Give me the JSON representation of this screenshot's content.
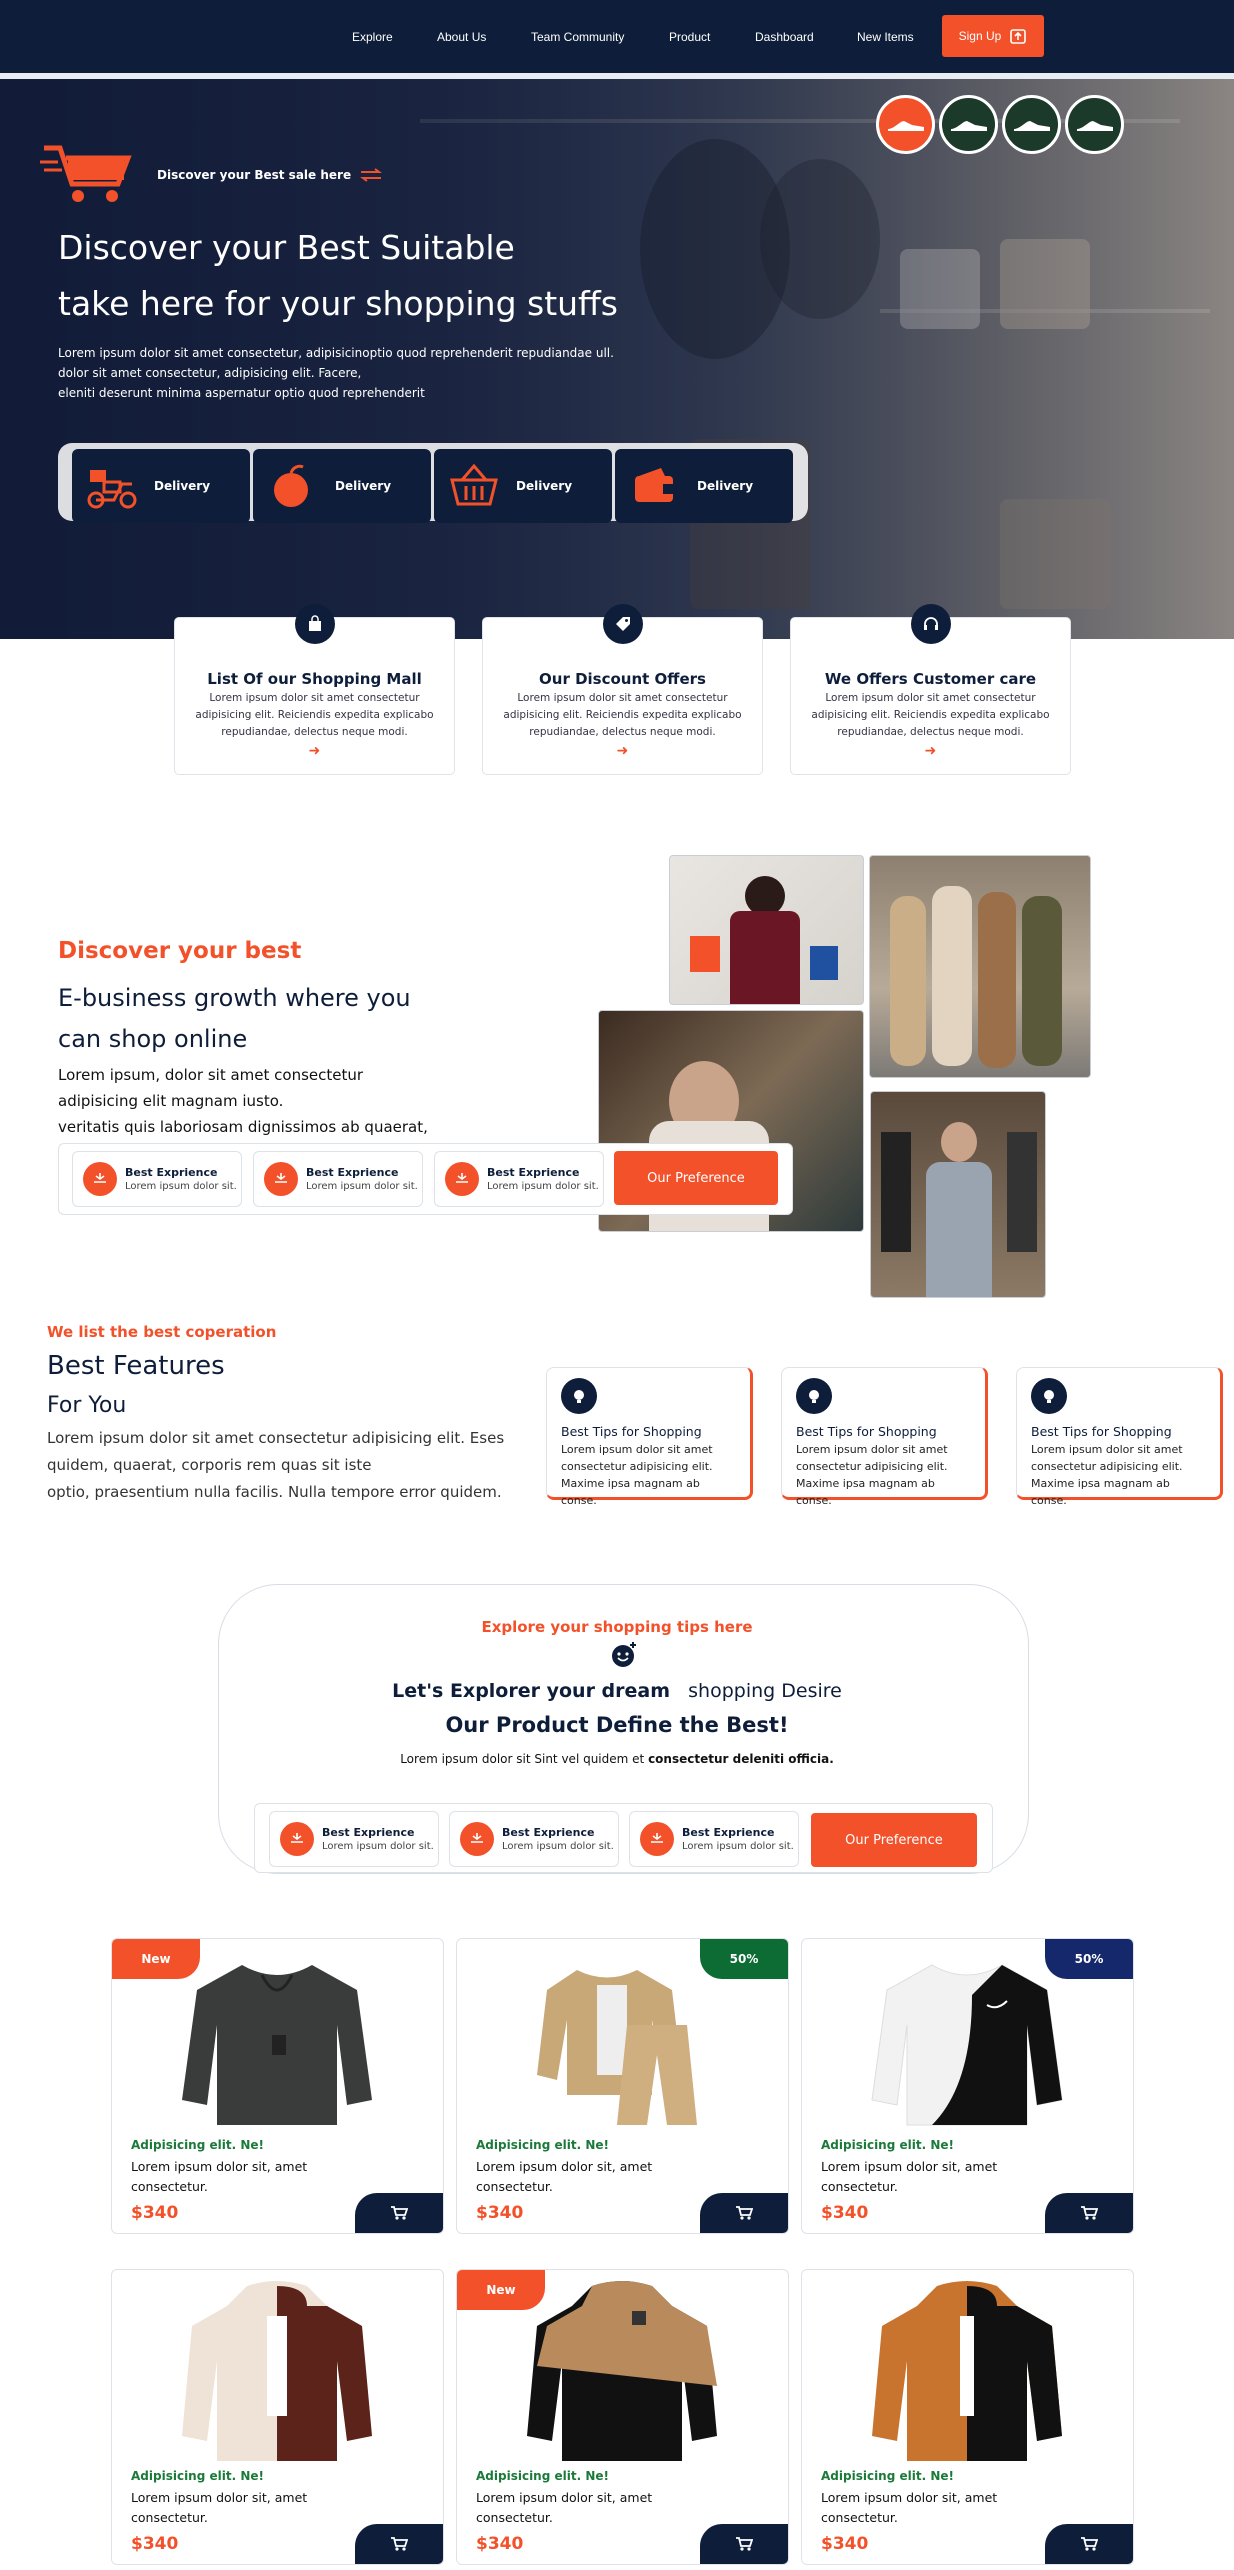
{
  "nav": {
    "items": [
      "Explore",
      "About Us",
      "Team Community",
      "Product",
      "Dashboard",
      "New Items"
    ],
    "signup_label": "Sign Up"
  },
  "hero": {
    "sale_label": "Discover your Best sale here",
    "title_line1": "Discover your Best Suitable",
    "title_line2": "take here for your shopping stuffs",
    "text_line1": "Lorem ipsum dolor sit amet consectetur, adipisicinoptio quod reprehenderit repudiandae ull.",
    "text_line2": "dolor sit amet consectetur, adipisicing elit. Facere,",
    "text_line3": "eleniti deserunt minima aspernatur optio quod reprehenderit",
    "delivery": [
      "Delivery",
      "Delivery",
      "Delivery",
      "Delivery"
    ]
  },
  "services": [
    {
      "title": "List Of our Shopping Mall",
      "text": "Lorem ipsum dolor sit amet consectetur adipisicing elit. Reiciendis expedita explicabo repudiandae, delectus neque modi."
    },
    {
      "title": "Our Discount Offers",
      "text": "Lorem ipsum dolor sit amet consectetur adipisicing elit. Reiciendis expedita explicabo repudiandae, delectus neque modi."
    },
    {
      "title": "We Offers Customer care",
      "text": "Lorem ipsum dolor sit amet consectetur adipisicing elit. Reiciendis expedita explicabo repudiandae, delectus neque modi."
    }
  ],
  "discover": {
    "kicker": "Discover your best",
    "title_line1": "E-business growth where you",
    "title_line2": "can shop online",
    "text_line1": "Lorem ipsum, dolor sit amet consectetur",
    "text_line2": "adipisicing elit magnam iusto.",
    "text_line3": "veritatis quis laboriosam dignissimos ab quaerat,",
    "experiences": [
      {
        "title": "Best Exprience",
        "sub": "Lorem ipsum dolor sit."
      },
      {
        "title": "Best Exprience",
        "sub": "Lorem ipsum dolor sit."
      },
      {
        "title": "Best Exprience",
        "sub": "Lorem ipsum dolor sit."
      }
    ],
    "button": "Our Preference"
  },
  "features": {
    "kicker": "We list the best coperation",
    "title": "Best Features",
    "subtitle": "For You",
    "text_line1": "Lorem ipsum dolor sit amet consectetur adipisicing elit. Eses",
    "text_line2": "quidem, quaerat, corporis rem quas sit iste",
    "text_line3": "optio, praesentium nulla facilis. Nulla tempore error quidem.",
    "tips": [
      {
        "title": "Best Tips for Shopping",
        "text": "Lorem ipsum dolor sit amet consectetur adipisicing elit. Maxime ipsa magnam ab conse."
      },
      {
        "title": "Best Tips for Shopping",
        "text": "Lorem ipsum dolor sit amet consectetur adipisicing elit. Maxime ipsa magnam ab conse."
      },
      {
        "title": "Best Tips for Shopping",
        "text": "Lorem ipsum dolor sit amet consectetur adipisicing elit. Maxime ipsa magnam ab conse."
      }
    ]
  },
  "explore": {
    "kicker": "Explore your shopping tips here",
    "heading_bold": "Let's Explorer your dream",
    "heading_rest": "shopping Desire",
    "heading2": "Our Product Define the Best!",
    "para": "Lorem ipsum dolor sit Sint vel quidem et",
    "para_bold": "consectetur deleniti officia.",
    "experiences": [
      {
        "title": "Best Exprience",
        "sub": "Lorem ipsum dolor sit."
      },
      {
        "title": "Best Exprience",
        "sub": "Lorem ipsum dolor sit."
      },
      {
        "title": "Best Exprience",
        "sub": "Lorem ipsum dolor sit."
      }
    ],
    "button": "Our Preference"
  },
  "products": [
    {
      "tag": "New",
      "tag_side": "left",
      "tag_color": "#f2512a",
      "category": "Adipisicing elit. Ne!",
      "desc": "Lorem ipsum dolor sit, amet consectetur.",
      "price": "$340",
      "item": "black-sweatshirt"
    },
    {
      "tag": "50%",
      "tag_side": "right",
      "tag_color": "#0d6b34",
      "category": "Adipisicing elit. Ne!",
      "desc": "Lorem ipsum dolor sit, amet consectetur.",
      "price": "$340",
      "item": "beige-tracksuit"
    },
    {
      "tag": "50%",
      "tag_side": "right",
      "tag_color": "#14286b",
      "category": "Adipisicing elit. Ne!",
      "desc": "Lorem ipsum dolor sit, amet consectetur.",
      "price": "$340",
      "item": "black-white-sweatshirt"
    },
    {
      "tag": "",
      "tag_side": "none",
      "tag_color": "",
      "category": "Adipisicing elit. Ne!",
      "desc": "Lorem ipsum dolor sit, amet consectetur.",
      "price": "$340",
      "item": "brown-cream-hoodie"
    },
    {
      "tag": "New",
      "tag_side": "left",
      "tag_color": "#f2512a",
      "category": "Adipisicing elit. Ne!",
      "desc": "Lorem ipsum dolor sit, amet consectetur.",
      "price": "$340",
      "item": "black-tan-hoodie"
    },
    {
      "tag": "",
      "tag_side": "none",
      "tag_color": "",
      "category": "Adipisicing elit. Ne!",
      "desc": "Lorem ipsum dolor sit, amet consectetur.",
      "price": "$340",
      "item": "orange-black-hoodie"
    }
  ],
  "colors": {
    "navy": "#0e1e3a",
    "accent": "#f2512a",
    "green": "#1b7a3a"
  }
}
